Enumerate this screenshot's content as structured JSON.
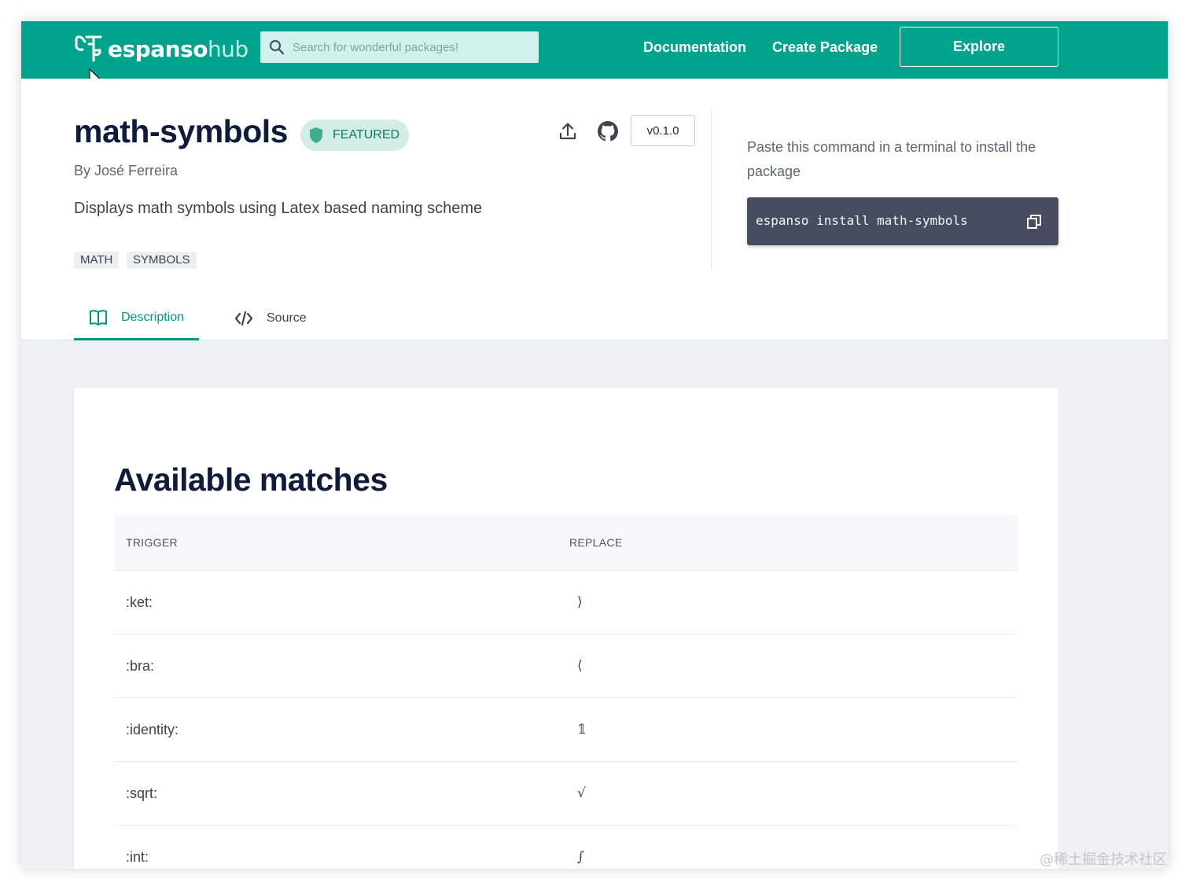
{
  "navbar": {
    "logo_bold": "espanso",
    "logo_light": "hub",
    "search_placeholder": "Search for wonderful packages!",
    "links": [
      "Documentation",
      "Create Package"
    ],
    "explore_label": "Explore"
  },
  "package": {
    "name": "math-symbols",
    "badge": "FEATURED",
    "author": "By José Ferreira",
    "description": "Displays math symbols using Latex based naming scheme",
    "tags": [
      "MATH",
      "SYMBOLS"
    ],
    "version": "v0.1.0",
    "install_hint": "Paste this command in a terminal to install the package",
    "install_command": "espanso install math-symbols"
  },
  "tabs": [
    {
      "label": "Description",
      "icon": "book-icon",
      "active": true
    },
    {
      "label": "Source",
      "icon": "code-icon",
      "active": false
    }
  ],
  "matches": {
    "heading": "Available matches",
    "columns": [
      "TRIGGER",
      "REPLACE"
    ],
    "rows": [
      {
        "trigger": ":ket:",
        "replace": "⟩"
      },
      {
        "trigger": ":bra:",
        "replace": "⟨"
      },
      {
        "trigger": ":identity:",
        "replace": "𝟙"
      },
      {
        "trigger": ":sqrt:",
        "replace": "√"
      },
      {
        "trigger": ":int:",
        "replace": "∫"
      }
    ]
  },
  "watermark": "@稀土掘金技术社区",
  "colors": {
    "brand": "#00a38b",
    "featured_bg": "#d3ede6",
    "command_bg": "#464d5f",
    "page_bg": "#eef1f5"
  }
}
